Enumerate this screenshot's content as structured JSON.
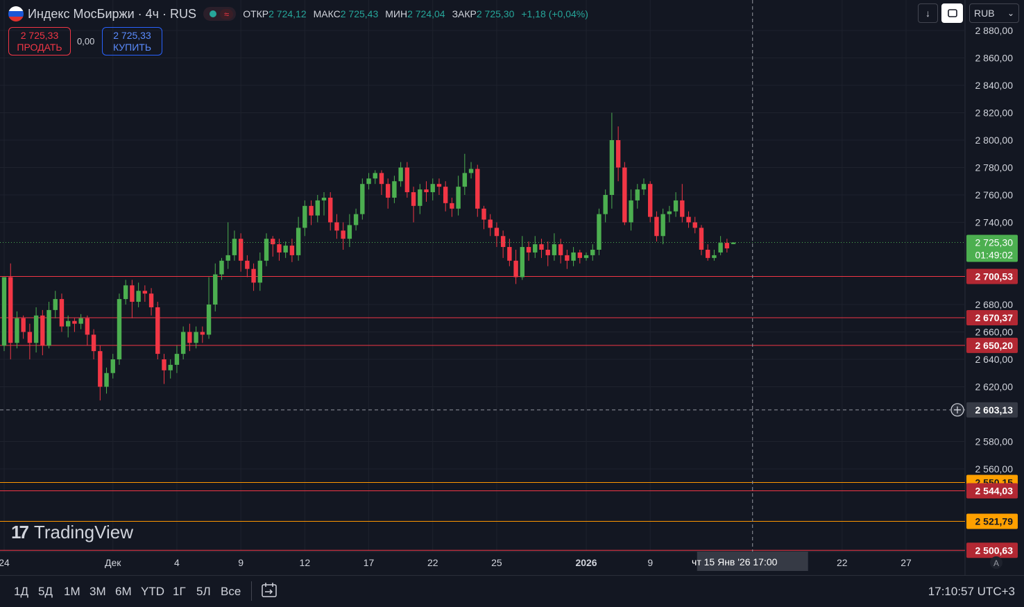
{
  "header": {
    "symbol": "Индекс МосБиржи · 4ч · RUS",
    "wave_icon": "≈",
    "ohlc": [
      {
        "label": "ОТКР",
        "value": "2 724,12"
      },
      {
        "label": "МАКС",
        "value": "2 725,43"
      },
      {
        "label": "МИН",
        "value": "2 724,04"
      },
      {
        "label": "ЗАКР",
        "value": "2 725,30"
      }
    ],
    "change": "+1,18 (+0,04%)"
  },
  "trade": {
    "sell_price": "2 725,33",
    "sell_label": "ПРОДАТЬ",
    "spread": "0,00",
    "buy_price": "2 725,33",
    "buy_label": "КУПИТЬ"
  },
  "toolbar": {
    "currency": "RUB",
    "download_icon": "↓",
    "chevron_icon": "⌄"
  },
  "brand": {
    "logo": "17",
    "name": "TradingView"
  },
  "bottom": {
    "ranges": [
      "1Д",
      "5Д",
      "1М",
      "3М",
      "6М",
      "YTD",
      "1Г",
      "5Л",
      "Все"
    ],
    "clock": "17:10:57 UTC+3",
    "auto_label": "A"
  },
  "colors": {
    "up": "#26a69a",
    "upBody": "#4caf50",
    "down": "#f23645",
    "bg": "#131722",
    "grid": "#1e222d",
    "orange": "#ff9800"
  },
  "chart_data": {
    "type": "candlestick",
    "y_range": [
      2490,
      2885
    ],
    "y_ticks": [
      {
        "v": 2880,
        "label": "2 880,00"
      },
      {
        "v": 2860,
        "label": "2 860,00"
      },
      {
        "v": 2840,
        "label": "2 840,00"
      },
      {
        "v": 2820,
        "label": "2 820,00"
      },
      {
        "v": 2800,
        "label": "2 800,00"
      },
      {
        "v": 2780,
        "label": "2 780,00"
      },
      {
        "v": 2760,
        "label": "2 760,00"
      },
      {
        "v": 2740,
        "label": "2 740,00"
      },
      {
        "v": 2680,
        "label": "2 680,00"
      },
      {
        "v": 2660,
        "label": "2 660,00"
      },
      {
        "v": 2640,
        "label": "2 640,00"
      },
      {
        "v": 2620,
        "label": "2 620,00"
      },
      {
        "v": 2580,
        "label": "2 580,00"
      },
      {
        "v": 2560,
        "label": "2 560,00"
      }
    ],
    "x_ticks": [
      "24",
      "Дек",
      "4",
      "9",
      "12",
      "17",
      "22",
      "25",
      "2026",
      "9",
      "22",
      "27"
    ],
    "x_tick_index": [
      0,
      17,
      27,
      37,
      47,
      57,
      67,
      77,
      91,
      101,
      131,
      141
    ],
    "last_price": {
      "value": 2725.3,
      "label": "2 725,30",
      "countdown": "01:49:02"
    },
    "levels": [
      {
        "value": 2700.53,
        "label": "2 700,53",
        "color": "#f23645"
      },
      {
        "value": 2670.37,
        "label": "2 670,37",
        "color": "#f23645"
      },
      {
        "value": 2650.2,
        "label": "2 650,20",
        "color": "#f23645"
      },
      {
        "value": 2550.15,
        "label": "2 550,15",
        "color": "#ff9800"
      },
      {
        "value": 2544.03,
        "label": "2 544,03",
        "color": "#f23645"
      },
      {
        "value": 2521.79,
        "label": "2 521,79",
        "color": "#ff9800"
      },
      {
        "value": 2500.63,
        "label": "2 500,63",
        "color": "#f23645"
      }
    ],
    "crosshair": {
      "price": 2603.13,
      "price_label": "2 603,13",
      "time_label": "чт 15 Янв '26   17:00",
      "index": 117
    },
    "candles": [
      [
        2650,
        2700,
        2646,
        2700
      ],
      [
        2700,
        2652,
        2640,
        2710
      ],
      [
        2652,
        2670,
        2648,
        2675
      ],
      [
        2670,
        2660,
        2655,
        2672
      ],
      [
        2660,
        2652,
        2640,
        2666
      ],
      [
        2652,
        2672,
        2645,
        2678
      ],
      [
        2672,
        2650,
        2643,
        2676
      ],
      [
        2650,
        2676,
        2648,
        2682
      ],
      [
        2676,
        2684,
        2670,
        2690
      ],
      [
        2684,
        2664,
        2660,
        2688
      ],
      [
        2664,
        2668,
        2656,
        2672
      ],
      [
        2668,
        2666,
        2660,
        2670
      ],
      [
        2666,
        2670,
        2662,
        2673
      ],
      [
        2670,
        2658,
        2650,
        2672
      ],
      [
        2658,
        2646,
        2640,
        2662
      ],
      [
        2646,
        2620,
        2610,
        2650
      ],
      [
        2620,
        2630,
        2615,
        2634
      ],
      [
        2630,
        2640,
        2626,
        2644
      ],
      [
        2640,
        2684,
        2636,
        2688
      ],
      [
        2684,
        2694,
        2680,
        2698
      ],
      [
        2694,
        2682,
        2670,
        2698
      ],
      [
        2682,
        2690,
        2678,
        2696
      ],
      [
        2690,
        2688,
        2682,
        2694
      ],
      [
        2688,
        2678,
        2672,
        2692
      ],
      [
        2678,
        2644,
        2640,
        2682
      ],
      [
        2640,
        2632,
        2622,
        2644
      ],
      [
        2632,
        2636,
        2626,
        2640
      ],
      [
        2636,
        2644,
        2630,
        2650
      ],
      [
        2644,
        2660,
        2640,
        2664
      ],
      [
        2660,
        2652,
        2646,
        2666
      ],
      [
        2652,
        2660,
        2648,
        2664
      ],
      [
        2660,
        2658,
        2652,
        2664
      ],
      [
        2658,
        2680,
        2655,
        2700
      ],
      [
        2680,
        2702,
        2675,
        2710
      ],
      [
        2702,
        2712,
        2698,
        2714
      ],
      [
        2712,
        2716,
        2706,
        2740
      ],
      [
        2716,
        2728,
        2712,
        2734
      ],
      [
        2728,
        2712,
        2704,
        2732
      ],
      [
        2712,
        2706,
        2700,
        2716
      ],
      [
        2706,
        2696,
        2690,
        2710
      ],
      [
        2696,
        2712,
        2690,
        2718
      ],
      [
        2712,
        2728,
        2708,
        2732
      ],
      [
        2728,
        2724,
        2715,
        2730
      ],
      [
        2724,
        2718,
        2712,
        2728
      ],
      [
        2718,
        2723,
        2714,
        2726
      ],
      [
        2723,
        2716,
        2711,
        2728
      ],
      [
        2716,
        2736,
        2712,
        2744
      ],
      [
        2736,
        2752,
        2730,
        2756
      ],
      [
        2752,
        2745,
        2738,
        2756
      ],
      [
        2745,
        2756,
        2740,
        2760
      ],
      [
        2756,
        2758,
        2745,
        2762
      ],
      [
        2758,
        2740,
        2734,
        2762
      ],
      [
        2740,
        2734,
        2728,
        2746
      ],
      [
        2734,
        2728,
        2720,
        2740
      ],
      [
        2728,
        2738,
        2722,
        2746
      ],
      [
        2738,
        2746,
        2734,
        2750
      ],
      [
        2746,
        2768,
        2742,
        2772
      ],
      [
        2768,
        2772,
        2764,
        2776
      ],
      [
        2772,
        2776,
        2768,
        2778
      ],
      [
        2776,
        2768,
        2760,
        2778
      ],
      [
        2768,
        2758,
        2750,
        2772
      ],
      [
        2758,
        2770,
        2754,
        2774
      ],
      [
        2770,
        2780,
        2766,
        2784
      ],
      [
        2780,
        2762,
        2758,
        2784
      ],
      [
        2762,
        2752,
        2740,
        2766
      ],
      [
        2752,
        2764,
        2746,
        2768
      ],
      [
        2764,
        2762,
        2755,
        2770
      ],
      [
        2762,
        2768,
        2756,
        2772
      ],
      [
        2768,
        2766,
        2760,
        2772
      ],
      [
        2766,
        2754,
        2748,
        2770
      ],
      [
        2754,
        2750,
        2744,
        2758
      ],
      [
        2750,
        2766,
        2745,
        2774
      ],
      [
        2766,
        2776,
        2760,
        2790
      ],
      [
        2776,
        2779,
        2772,
        2784
      ],
      [
        2779,
        2750,
        2744,
        2782
      ],
      [
        2750,
        2742,
        2735,
        2752
      ],
      [
        2742,
        2736,
        2730,
        2746
      ],
      [
        2736,
        2730,
        2722,
        2740
      ],
      [
        2730,
        2722,
        2714,
        2734
      ],
      [
        2722,
        2712,
        2708,
        2728
      ],
      [
        2712,
        2700,
        2695,
        2720
      ],
      [
        2700,
        2722,
        2698,
        2730
      ],
      [
        2722,
        2718,
        2712,
        2726
      ],
      [
        2718,
        2724,
        2714,
        2730
      ],
      [
        2724,
        2720,
        2714,
        2728
      ],
      [
        2720,
        2716,
        2708,
        2726
      ],
      [
        2716,
        2724,
        2712,
        2732
      ],
      [
        2724,
        2716,
        2710,
        2728
      ],
      [
        2716,
        2712,
        2706,
        2720
      ],
      [
        2712,
        2718,
        2708,
        2722
      ],
      [
        2718,
        2714,
        2710,
        2720
      ],
      [
        2714,
        2716,
        2712,
        2718
      ],
      [
        2716,
        2720,
        2712,
        2724
      ],
      [
        2720,
        2746,
        2716,
        2750
      ],
      [
        2746,
        2760,
        2740,
        2764
      ],
      [
        2760,
        2800,
        2750,
        2820
      ],
      [
        2800,
        2780,
        2770,
        2810
      ],
      [
        2780,
        2740,
        2738,
        2784
      ],
      [
        2740,
        2756,
        2734,
        2764
      ],
      [
        2756,
        2764,
        2750,
        2768
      ],
      [
        2764,
        2768,
        2760,
        2772
      ],
      [
        2768,
        2744,
        2740,
        2770
      ],
      [
        2744,
        2730,
        2726,
        2748
      ],
      [
        2730,
        2746,
        2724,
        2750
      ],
      [
        2746,
        2748,
        2740,
        2752
      ],
      [
        2748,
        2756,
        2744,
        2762
      ],
      [
        2756,
        2744,
        2740,
        2768
      ],
      [
        2744,
        2740,
        2736,
        2748
      ],
      [
        2740,
        2736,
        2732,
        2744
      ],
      [
        2736,
        2720,
        2716,
        2738
      ],
      [
        2720,
        2714,
        2712,
        2724
      ],
      [
        2714,
        2716,
        2712,
        2720
      ],
      [
        2718,
        2725,
        2716,
        2730
      ],
      [
        2725,
        2721,
        2718,
        2728
      ],
      [
        2724.12,
        2725.3,
        2724.04,
        2725.43
      ]
    ]
  }
}
